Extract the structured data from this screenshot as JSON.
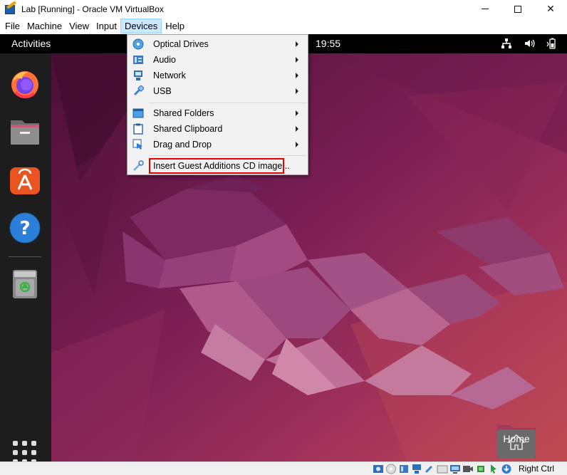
{
  "window": {
    "title": "Lab [Running] - Oracle VM VirtualBox",
    "controls": {
      "minimize": "minimize-icon",
      "maximize": "maximize-icon",
      "close": "✕"
    }
  },
  "menubar": {
    "items": [
      {
        "label": "File"
      },
      {
        "label": "Machine"
      },
      {
        "label": "View"
      },
      {
        "label": "Input"
      },
      {
        "label": "Devices",
        "active": true
      },
      {
        "label": "Help"
      }
    ]
  },
  "devices_menu": {
    "items": [
      {
        "label": "Optical Drives",
        "icon": "optical-disc-icon",
        "submenu": true
      },
      {
        "label": "Audio",
        "icon": "audio-icon",
        "submenu": true
      },
      {
        "label": "Network",
        "icon": "network-icon",
        "submenu": true
      },
      {
        "label": "USB",
        "icon": "usb-icon",
        "submenu": true
      },
      {
        "label": "Shared Folders",
        "icon": "shared-folder-icon",
        "submenu": true
      },
      {
        "label": "Shared Clipboard",
        "icon": "clipboard-icon",
        "submenu": true
      },
      {
        "label": "Drag and Drop",
        "icon": "drag-drop-icon",
        "submenu": true
      },
      {
        "label": "Insert Guest Additions CD image...",
        "icon": "guest-additions-icon",
        "submenu": false,
        "highlighted": true
      }
    ],
    "highlight_color": "#e60000"
  },
  "guest": {
    "topbar": {
      "activities": "Activities",
      "clock": "19:55"
    },
    "tray_icons": [
      "network-wired-icon",
      "volume-icon",
      "battery-icon"
    ],
    "dock": [
      "firefox-icon",
      "files-icon",
      "app-center-icon",
      "help-icon",
      "trash-icon"
    ],
    "show_apps_icon": "show-apps-grid-icon",
    "desktop_home_label": "Home"
  },
  "statusbar": {
    "icons": [
      "hard-disk-icon",
      "optical-drive-icon",
      "audio-status-icon",
      "network-status-icon",
      "usb-status-icon",
      "shared-folder-status-icon",
      "display-status-icon",
      "recording-icon",
      "cpu-icon",
      "mouse-integration-icon",
      "keyboard-icon"
    ],
    "host_key": "Right Ctrl"
  },
  "colors": {
    "menu_highlight": "#cce8ff",
    "wallpaper_base": "#7a1f55",
    "dock": "#1d1d1d"
  }
}
